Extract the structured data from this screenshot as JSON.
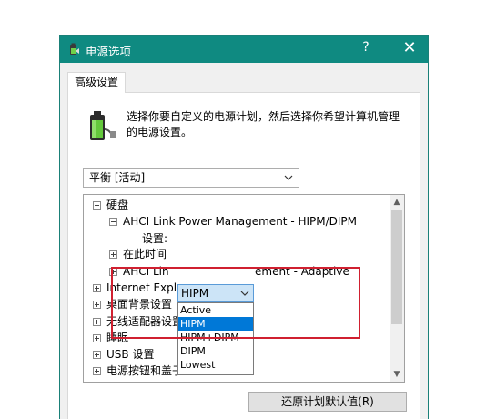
{
  "window": {
    "title": "电源选项",
    "help": "?",
    "close": "✕"
  },
  "tab": {
    "label": "高级设置"
  },
  "description": "选择你要自定义的电源计划，然后选择你希望计算机管理的电源设置。",
  "plan_select": {
    "value": "平衡 [活动]"
  },
  "tree": {
    "hard_disk": "硬盘",
    "ahci": "AHCI Link Power Management - HIPM/DIPM",
    "setting_label": "设置:",
    "setting_value": "HIPM",
    "idle_after_partial": "在此时间",
    "ahci_adaptive_partial_left": "AHCI Lin",
    "ahci_adaptive_partial_right": "ement - Adaptive",
    "ie_partial": "Internet Expl",
    "desktop_bg_partial": "桌面背景设置",
    "wireless": "无线适配器设置",
    "sleep": "睡眠",
    "usb": "USB 设置",
    "power_buttons": "电源按钮和盖子"
  },
  "dropdown_options": [
    "Active",
    "HIPM",
    "HIPM+DIPM",
    "DIPM",
    "Lowest"
  ],
  "dropdown_selected": "HIPM",
  "restore_button": "还原计划默认值(R)",
  "colors": {
    "titlebar": "#0f8a81",
    "selection": "#0078d7",
    "highlight": "#d02030"
  }
}
